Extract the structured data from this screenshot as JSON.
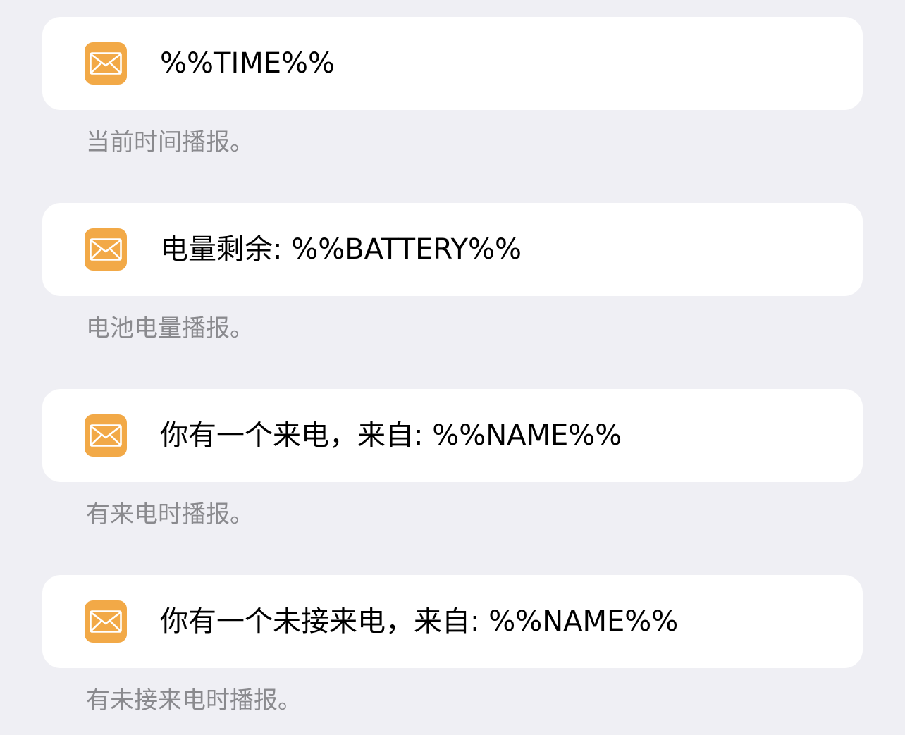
{
  "colors": {
    "background": "#efeff4",
    "card": "#ffffff",
    "icon_bg": "#f2a947",
    "caption": "#8a8a8e"
  },
  "items": [
    {
      "icon": "mail-icon",
      "text": "%%TIME%%",
      "caption": "当前时间播报。"
    },
    {
      "icon": "mail-icon",
      "text": "电量剩余: %%BATTERY%%",
      "caption": "电池电量播报。"
    },
    {
      "icon": "mail-icon",
      "text": "你有一个来电，来自: %%NAME%%",
      "caption": "有来电时播报。"
    },
    {
      "icon": "mail-icon",
      "text": "你有一个未接来电，来自: %%NAME%%",
      "caption": "有未接来电时播报。"
    }
  ]
}
